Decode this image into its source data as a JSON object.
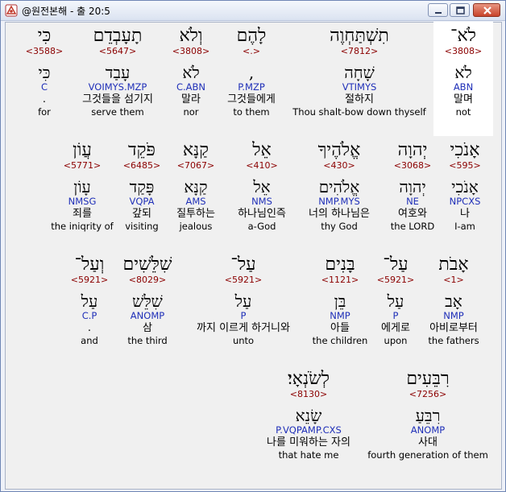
{
  "window": {
    "title": "@원전본해 - 출 20:5"
  },
  "rows": [
    {
      "words": [
        {
          "id": "w1",
          "heb": "לֹא־",
          "num": "<3808>",
          "lex": "לֹא",
          "code": "ABN",
          "kor": "말며",
          "eng": "not",
          "highlight": true
        },
        {
          "id": "w2",
          "heb": "תִשְׁתַּחְוֶה",
          "num": "<7812>",
          "lex": "שָׁחָה",
          "code": "VTIMYS",
          "kor": "절하지",
          "eng": "Thou shalt-bow down thyself"
        },
        {
          "id": "w3",
          "heb": "לָהֶם",
          "num": "<.>",
          "lex": ",",
          "code": "P.MZP",
          "kor": "그것들에게",
          "eng": "to them"
        },
        {
          "id": "w4",
          "heb": "וְלֹא",
          "num": "<3808>",
          "lex": "לֹא",
          "code": "C.ABN",
          "kor": "말라",
          "eng": "nor"
        },
        {
          "id": "w5",
          "heb": "תָעָבְדֵם",
          "num": "<5647>",
          "lex": "עָבַד",
          "code": "VOIMYS.MZP",
          "kor": "그것들을 섬기지",
          "eng": "serve them"
        },
        {
          "id": "w6",
          "heb": "כִּי",
          "num": "<3588>",
          "lex": "כִּי",
          "code": "C",
          "kor": ".",
          "eng": "for"
        }
      ]
    },
    {
      "words": [
        {
          "id": "w7",
          "heb": "אָנֹכִי",
          "num": "<595>",
          "lex": "אָנֹכִי",
          "code": "NPCXS",
          "kor": "나",
          "eng": "I-am"
        },
        {
          "id": "w8",
          "heb": "יְהוָה",
          "num": "<3068>",
          "lex": "יְהוָה",
          "code": "NE",
          "kor": "여호와",
          "eng": "the LORD"
        },
        {
          "id": "w9",
          "heb": "אֱלֹהֶיךָ",
          "num": "<430>",
          "lex": "אֱלֹהִים",
          "code": "NMP.MYS",
          "kor": "너의 하나님은",
          "eng": "thy God"
        },
        {
          "id": "w10",
          "heb": "אֵל",
          "num": "<410>",
          "lex": "אֵל",
          "code": "NMS",
          "kor": "하나님인즉",
          "eng": "a-God"
        },
        {
          "id": "w11",
          "heb": "קַנָּא",
          "num": "<7067>",
          "lex": "קַנָּא",
          "code": "AMS",
          "kor": "질투하는",
          "eng": "jealous"
        },
        {
          "id": "w12",
          "heb": "פֹּקֵד",
          "num": "<6485>",
          "lex": "פָּקַד",
          "code": "VQPA",
          "kor": "갚되",
          "eng": "visiting"
        },
        {
          "id": "w13",
          "heb": "עֲוֹן",
          "num": "<5771>",
          "lex": "עָוֹן",
          "code": "NMSG",
          "kor": "죄를",
          "eng": "the iniqrity of"
        }
      ]
    },
    {
      "words": [
        {
          "id": "w14",
          "heb": "אָבֹת",
          "num": "<1>",
          "lex": "אָב",
          "code": "NMP",
          "kor": "아비로부터",
          "eng": "the fathers"
        },
        {
          "id": "w15",
          "heb": "עַל־",
          "num": "<5921>",
          "lex": "עַל",
          "code": "P",
          "kor": "에게로",
          "eng": "upon"
        },
        {
          "id": "w16",
          "heb": "בָּנִים",
          "num": "<1121>",
          "lex": "בֵּן",
          "code": "NMP",
          "kor": "아들",
          "eng": "the children"
        },
        {
          "id": "w17",
          "heb": "עַל־",
          "num": "<5921>",
          "lex": "עַל",
          "code": "P",
          "kor": "까지 이르게 하거니와",
          "eng": "unto"
        },
        {
          "id": "w18",
          "heb": "שִׁלֵּשִׁים",
          "num": "<8029>",
          "lex": "שִׁלֵּשׁ",
          "code": "ANOMP",
          "kor": "삼",
          "eng": "the third"
        },
        {
          "id": "w19",
          "heb": "וְעַל־",
          "num": "<5921>",
          "lex": "עַל",
          "code": "C.P",
          "kor": ".",
          "eng": "and"
        }
      ]
    },
    {
      "words": [
        {
          "id": "w20",
          "heb": "רִבֵּעִים",
          "num": "<7256>",
          "lex": "רִבֵּעַ",
          "code": "ANOMP",
          "kor": "사대",
          "eng": "fourth generation of them"
        },
        {
          "id": "w21",
          "heb": "לְשֹׂנְאָי׃",
          "num": "<8130>",
          "lex": "שָׂנֵא",
          "code": "P.VQPAMP.CXS",
          "kor": "나를 미워하는 자의",
          "eng": "that hate me"
        }
      ]
    }
  ]
}
